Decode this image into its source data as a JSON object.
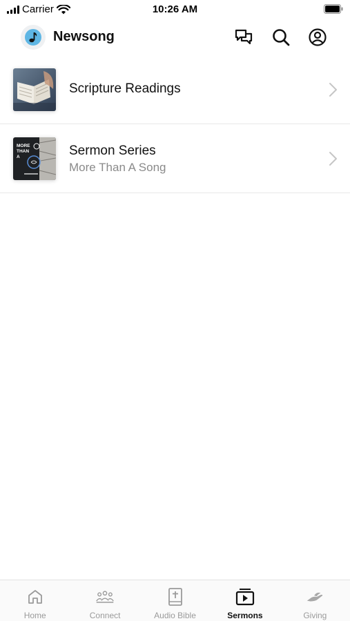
{
  "status_bar": {
    "carrier": "Carrier",
    "time": "10:26 AM"
  },
  "header": {
    "title": "Newsong",
    "logo_icon": "music-note-icon",
    "actions": [
      "chat-icon",
      "search-icon",
      "account-icon"
    ]
  },
  "list": [
    {
      "title": "Scripture Readings",
      "subtitle": "",
      "thumb": "open-bible-photo"
    },
    {
      "title": "Sermon Series",
      "subtitle": "More Than A Song",
      "thumb": "more-than-a-song-cover",
      "thumb_text": "MORE THAN A"
    }
  ],
  "tabs": [
    {
      "label": "Home",
      "icon": "home-icon",
      "active": false
    },
    {
      "label": "Connect",
      "icon": "people-icon",
      "active": false
    },
    {
      "label": "Audio Bible",
      "icon": "bible-icon",
      "active": false
    },
    {
      "label": "Sermons",
      "icon": "play-video-icon",
      "active": true
    },
    {
      "label": "Giving",
      "icon": "giving-hand-icon",
      "active": false
    }
  ],
  "colors": {
    "accent": "#5eb6e4",
    "active_tab": "#111111",
    "inactive_tab": "#9a9a9a",
    "subtitle": "#8a8a8a"
  }
}
